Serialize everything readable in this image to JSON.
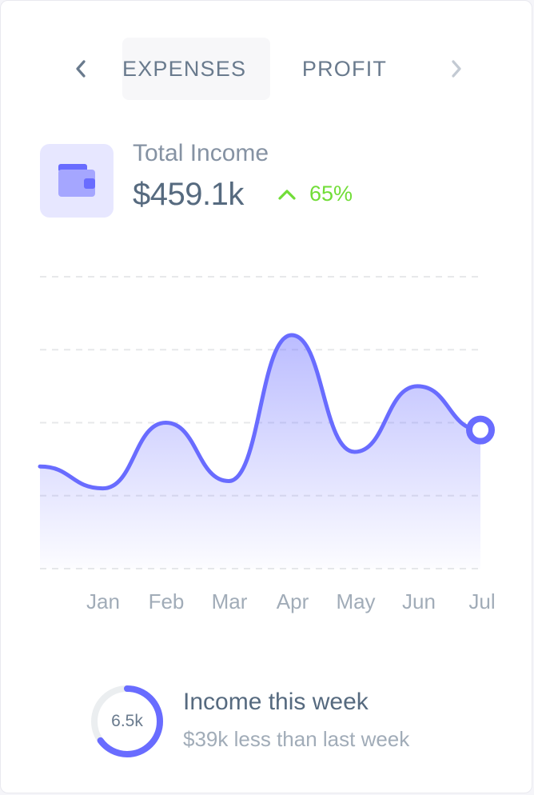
{
  "tabs": {
    "items": [
      {
        "label": "EXPENSES",
        "active": true
      },
      {
        "label": "PROFIT",
        "active": false
      }
    ],
    "prev_icon": "chevron-left-icon",
    "next_icon": "chevron-right-icon"
  },
  "summary": {
    "icon": "wallet-icon",
    "label": "Total Income",
    "value": "$459.1k",
    "change": "65%",
    "change_direction": "up",
    "change_icon": "chevron-up-icon"
  },
  "colors": {
    "primary": "#696cff",
    "success": "#71dd37",
    "heading": "#566a7f",
    "muted": "#a1acb8"
  },
  "chart_data": {
    "type": "area",
    "categories": [
      "Jan",
      "Feb",
      "Mar",
      "Apr",
      "May",
      "Jun",
      "Jul"
    ],
    "series": [
      {
        "values": [
          24,
          21,
          30,
          22,
          42,
          26,
          35,
          29
        ]
      }
    ],
    "ylim": [
      10,
      50
    ],
    "grid": true,
    "marker_on_last": true
  },
  "week": {
    "ring_value": "6.5k",
    "ring_progress": 0.65,
    "title": "Income this week",
    "subtitle": "$39k less than last week"
  }
}
